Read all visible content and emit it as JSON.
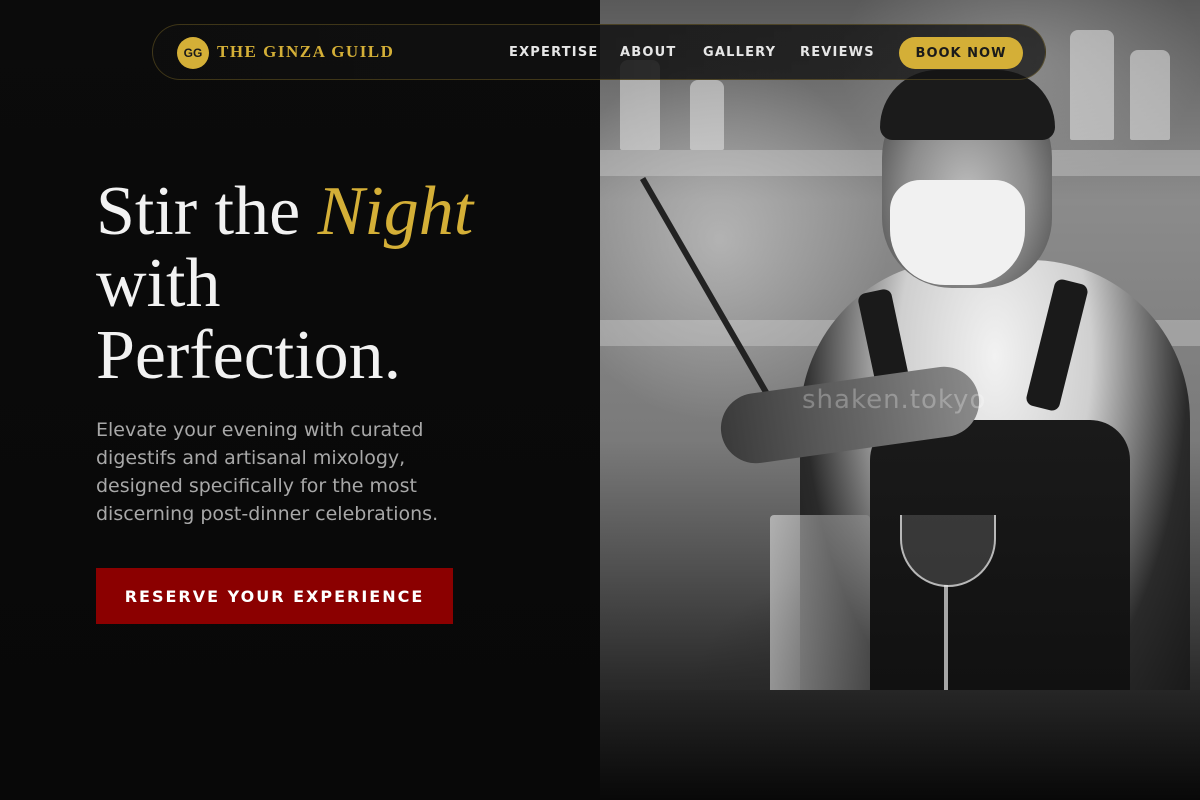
{
  "brand": {
    "initials": "GG",
    "name": "THE GINZA GUILD"
  },
  "nav": {
    "links": [
      "EXPERTISE",
      "ABOUT",
      "GALLERY",
      "REVIEWS"
    ],
    "book_label": "BOOK NOW"
  },
  "hero": {
    "headline_part1": "Stir the ",
    "headline_accent": "Night",
    "headline_line2": "with",
    "headline_line3": "Perfection.",
    "subtext": "Elevate your evening with curated digestifs and artisanal mixology, designed specifically for the most discerning post-dinner celebrations.",
    "cta_label": "RESERVE YOUR EXPERIENCE"
  },
  "image": {
    "watermark": "shaken.tokyo"
  },
  "colors": {
    "accent_gold": "#d4af37",
    "cta_red": "#8b0000",
    "background": "#0a0a0a",
    "text_light": "#f2f2f2",
    "text_muted": "#a8a8a8"
  }
}
